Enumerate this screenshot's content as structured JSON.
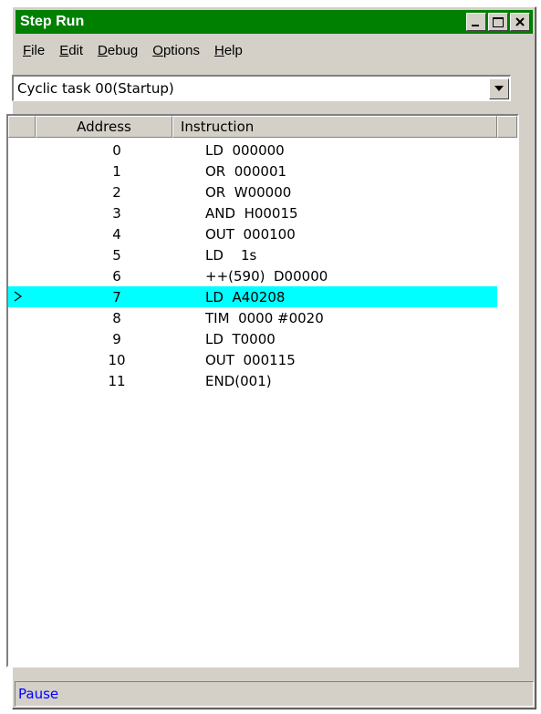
{
  "window": {
    "title": "Step Run",
    "title_bar_color": "#008000",
    "controls": [
      "minimize-icon",
      "maximize-icon",
      "close-icon"
    ]
  },
  "menubar": {
    "items": [
      {
        "label": "File",
        "mnemonic": "F",
        "rest": "ile"
      },
      {
        "label": "Edit",
        "mnemonic": "E",
        "rest": "dit"
      },
      {
        "label": "Debug",
        "mnemonic": "D",
        "rest": "ebug"
      },
      {
        "label": "Options",
        "mnemonic": "O",
        "rest": "ptions"
      },
      {
        "label": "Help",
        "mnemonic": "H",
        "rest": "elp"
      }
    ]
  },
  "task_select": {
    "value": "Cyclic task 00(Startup)"
  },
  "table": {
    "columns": [
      "",
      "Address",
      "Instruction"
    ],
    "current_row_index": 7,
    "current_marker": "current-step-arrow-icon",
    "highlight_color": "#00ffff",
    "rows": [
      {
        "address": "0",
        "instruction": "LD  000000"
      },
      {
        "address": "1",
        "instruction": "OR  000001"
      },
      {
        "address": "2",
        "instruction": "OR  W00000"
      },
      {
        "address": "3",
        "instruction": "AND  H00015"
      },
      {
        "address": "4",
        "instruction": "OUT  000100"
      },
      {
        "address": "5",
        "instruction": "LD    1s"
      },
      {
        "address": "6",
        "instruction": "++(590)  D00000"
      },
      {
        "address": "7",
        "instruction": "LD  A40208"
      },
      {
        "address": "8",
        "instruction": "TIM  0000 #0020"
      },
      {
        "address": "9",
        "instruction": "LD  T0000"
      },
      {
        "address": "10",
        "instruction": "OUT  000115"
      },
      {
        "address": "11",
        "instruction": "END(001)"
      }
    ]
  },
  "status": {
    "text": "Pause",
    "color": "#0000ff"
  }
}
